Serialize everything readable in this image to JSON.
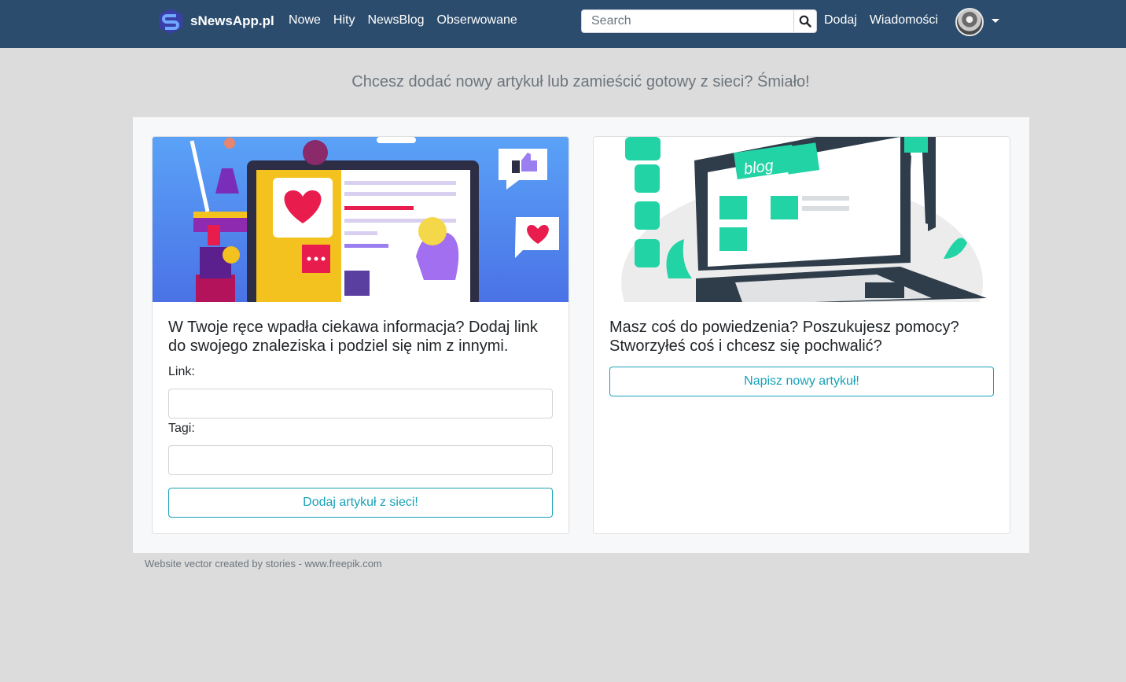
{
  "nav": {
    "brand": "sNewsApp.pl",
    "links": [
      "Nowe",
      "Hity",
      "NewsBlog",
      "Obserwowane"
    ],
    "search_placeholder": "Search",
    "right_links": [
      "Dodaj",
      "Wiadomości"
    ]
  },
  "page": {
    "headline": "Chcesz dodać nowy artykuł lub zamieścić gotowy z sieci? Śmiało!",
    "left_card": {
      "text": "W Twoje ręce wpadła ciekawa informacja? Dodaj link do swojego znaleziska i podziel się nim z innymi.",
      "link_label": "Link:",
      "tags_label": "Tagi:",
      "button": "Dodaj artykuł z sieci!"
    },
    "right_card": {
      "text": "Masz coś do powiedzenia? Poszukujesz pomocy? Stworzyłeś coś i chcesz się pochwalić?",
      "button": "Napisz nowy artykuł!",
      "image_text": "blog"
    },
    "credit": "Website vector created by stories - www.freepik.com"
  }
}
